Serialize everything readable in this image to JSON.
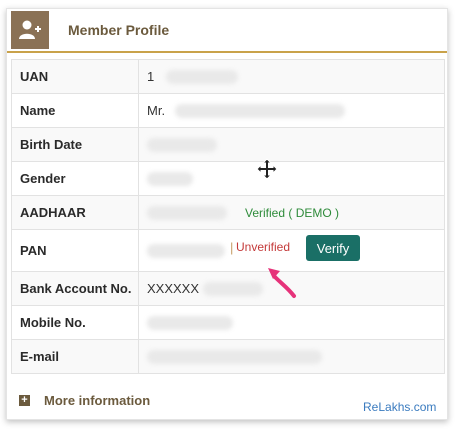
{
  "header": {
    "title": "Member Profile",
    "icon": "add-user-icon",
    "accent_color": "#c9a24a",
    "icon_bg": "#8a7155"
  },
  "rows": [
    {
      "label": "UAN",
      "value": "1"
    },
    {
      "label": "Name",
      "value": "Mr."
    },
    {
      "label": "Birth Date",
      "value": ""
    },
    {
      "label": "Gender",
      "value": ""
    },
    {
      "label": "AADHAAR",
      "value": "",
      "status": "Verified ( DEMO )"
    },
    {
      "label": "PAN",
      "value": "",
      "status": "Unverified",
      "action": "Verify"
    },
    {
      "label": "Bank Account No.",
      "value": "XXXXXX"
    },
    {
      "label": "Mobile No.",
      "value": ""
    },
    {
      "label": "E-mail",
      "value": ""
    }
  ],
  "footer": {
    "more_label": "More information",
    "watermark": "ReLakhs.com"
  },
  "colors": {
    "verified": "#2e8b3a",
    "unverified": "#c43a3a",
    "verify_button": "#1a6f66",
    "annotation_arrow": "#e6337a"
  }
}
